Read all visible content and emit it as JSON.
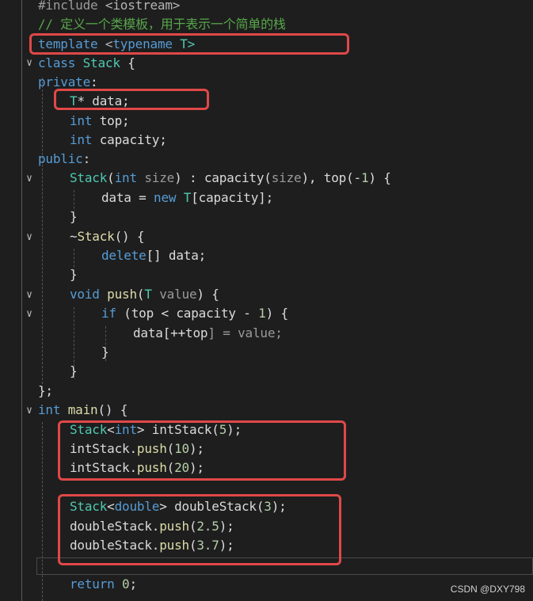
{
  "code": {
    "l1": {
      "a": "#include ",
      "b": "<iostream>"
    },
    "l2": "// 定义一个类模板，用于表示一个简单的栈",
    "l3": {
      "a": "template",
      "b": " <",
      "c": "typename",
      "d": " T>"
    },
    "l4": {
      "a": "class",
      "b": " Stack",
      "c": " {"
    },
    "l5": {
      "a": "private",
      "b": ":"
    },
    "l6": {
      "a": "T",
      "b": "* data;"
    },
    "l7": {
      "a": "int",
      "b": " top;"
    },
    "l8": {
      "a": "int",
      "b": " capacity;"
    },
    "l9": {
      "a": "public",
      "b": ":"
    },
    "l10": {
      "a": "Stack",
      "b": "(",
      "c": "int",
      "d": " size",
      "e": ") : ",
      "f": "capacity",
      "g": "(",
      "h": "size",
      "i": "), ",
      "j": "top",
      "k": "(-",
      "l": "1",
      "m": ") {"
    },
    "l11": {
      "a": "data",
      "b": " = ",
      "c": "new",
      "d": " ",
      "e": "T",
      "f": "[",
      "g": "capacity",
      "h": "];"
    },
    "l12": "}",
    "l13": {
      "a": "~",
      "b": "Stack",
      "c": "() {"
    },
    "l14": {
      "a": "delete",
      "b": "[] data;"
    },
    "l15": "}",
    "l16": {
      "a": "void",
      "b": " push",
      "c": "(",
      "d": "T",
      "e": " value",
      "f": ") {"
    },
    "l17": {
      "a": "if",
      "b": " (",
      "c": "top",
      "d": " < ",
      "e": "capacity",
      "f": " - ",
      "g": "1",
      "h": ") {"
    },
    "l18": {
      "a": "data",
      "b": "[++",
      "c": "top",
      "d": "] = value;"
    },
    "l19": "}",
    "l20": "}",
    "l21": "};",
    "l22": {
      "a": "int",
      "b": " main",
      "c": "() {"
    },
    "l23": {
      "a": "Stack",
      "b": "<",
      "c": "int",
      "d": "> ",
      "e": "intStack",
      "f": "(",
      "g": "5",
      "h": ");"
    },
    "l24": {
      "a": "intStack",
      "b": ".",
      "c": "push",
      "d": "(",
      "e": "10",
      "f": ");"
    },
    "l25": {
      "a": "intStack",
      "b": ".",
      "c": "push",
      "d": "(",
      "e": "20",
      "f": ");"
    },
    "l27": {
      "a": "Stack",
      "b": "<",
      "c": "double",
      "d": "> ",
      "e": "doubleStack",
      "f": "(",
      "g": "3",
      "h": ");"
    },
    "l28": {
      "a": "doubleStack",
      "b": ".",
      "c": "push",
      "d": "(",
      "e": "2.5",
      "f": ");"
    },
    "l29": {
      "a": "doubleStack",
      "b": ".",
      "c": "push",
      "d": "(",
      "e": "3.7",
      "f": ");"
    },
    "l31": {
      "a": "return",
      "b": " ",
      "c": "0",
      "d": ";"
    }
  },
  "fold_glyph": "∨",
  "watermark": "CSDN @DXY798",
  "colors": {
    "highlight_box": "#e04848",
    "background": "#1e1e1e"
  }
}
